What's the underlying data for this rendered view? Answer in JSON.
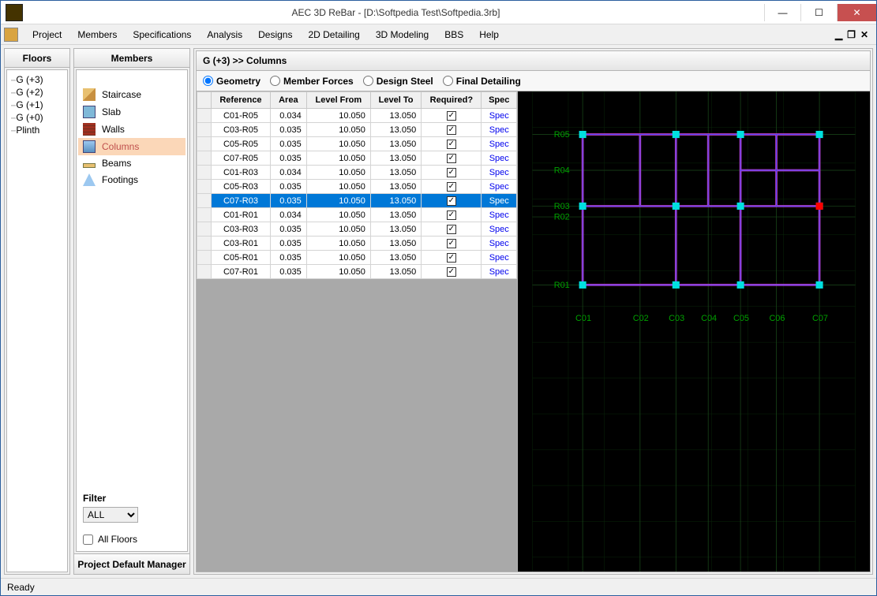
{
  "window": {
    "title": "AEC 3D ReBar - [D:\\Softpedia Test\\Softpedia.3rb]"
  },
  "menu": [
    "Project",
    "Members",
    "Specifications",
    "Analysis",
    "Designs",
    "2D Detailing",
    "3D Modeling",
    "BBS",
    "Help"
  ],
  "floors": {
    "header": "Floors",
    "items": [
      "G (+3)",
      "G (+2)",
      "G (+1)",
      "G (+0)",
      "Plinth"
    ]
  },
  "members": {
    "header": "Members",
    "items": [
      {
        "label": "Staircase",
        "icon": "stair"
      },
      {
        "label": "Slab",
        "icon": "slab"
      },
      {
        "label": "Walls",
        "icon": "wall"
      },
      {
        "label": "Columns",
        "icon": "column",
        "selected": true
      },
      {
        "label": "Beams",
        "icon": "beam"
      },
      {
        "label": "Footings",
        "icon": "footing"
      }
    ],
    "filter_label": "Filter",
    "filter_value": "ALL",
    "all_floors_label": "All Floors",
    "pdm_label": "Project Default Manager"
  },
  "content": {
    "header": "G (+3) >> Columns",
    "tabs": [
      "Geometry",
      "Member Forces",
      "Design Steel",
      "Final Detailing"
    ],
    "selected_tab": 0,
    "columns": [
      "Reference",
      "Area",
      "Level From",
      "Level To",
      "Required?",
      "Spec"
    ],
    "rows": [
      {
        "ref": "C01-R05",
        "area": "0.034",
        "from": "10.050",
        "to": "13.050",
        "req": true,
        "spec": "Spec"
      },
      {
        "ref": "C03-R05",
        "area": "0.035",
        "from": "10.050",
        "to": "13.050",
        "req": true,
        "spec": "Spec"
      },
      {
        "ref": "C05-R05",
        "area": "0.035",
        "from": "10.050",
        "to": "13.050",
        "req": true,
        "spec": "Spec"
      },
      {
        "ref": "C07-R05",
        "area": "0.035",
        "from": "10.050",
        "to": "13.050",
        "req": true,
        "spec": "Spec"
      },
      {
        "ref": "C01-R03",
        "area": "0.034",
        "from": "10.050",
        "to": "13.050",
        "req": true,
        "spec": "Spec"
      },
      {
        "ref": "C05-R03",
        "area": "0.035",
        "from": "10.050",
        "to": "13.050",
        "req": true,
        "spec": "Spec"
      },
      {
        "ref": "C07-R03",
        "area": "0.035",
        "from": "10.050",
        "to": "13.050",
        "req": true,
        "spec": "Spec",
        "selected": true
      },
      {
        "ref": "C01-R01",
        "area": "0.034",
        "from": "10.050",
        "to": "13.050",
        "req": true,
        "spec": "Spec"
      },
      {
        "ref": "C03-R03",
        "area": "0.035",
        "from": "10.050",
        "to": "13.050",
        "req": true,
        "spec": "Spec"
      },
      {
        "ref": "C03-R01",
        "area": "0.035",
        "from": "10.050",
        "to": "13.050",
        "req": true,
        "spec": "Spec"
      },
      {
        "ref": "C05-R01",
        "area": "0.035",
        "from": "10.050",
        "to": "13.050",
        "req": true,
        "spec": "Spec"
      },
      {
        "ref": "C07-R01",
        "area": "0.035",
        "from": "10.050",
        "to": "13.050",
        "req": true,
        "spec": "Spec"
      }
    ]
  },
  "viewport": {
    "row_labels": [
      "R05",
      "R04",
      "R03",
      "R02",
      "R01"
    ],
    "col_labels": [
      "C01",
      "C02",
      "C03",
      "C04",
      "C05",
      "C06",
      "C07"
    ]
  },
  "status": "Ready"
}
